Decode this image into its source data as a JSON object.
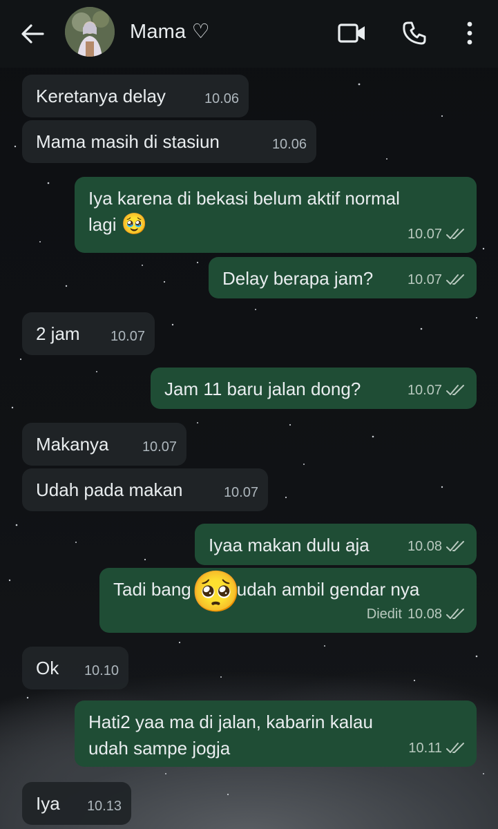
{
  "header": {
    "title": "Mama ♡",
    "icons": [
      "back-arrow-icon",
      "video-call-icon",
      "phone-icon",
      "more-vertical-icon"
    ]
  },
  "colors": {
    "incoming_bubble": "#202428",
    "outgoing_bubble": "#1f4d35",
    "header_bg": "#111416"
  },
  "messages": [
    {
      "dir": "in",
      "text": "Keretanya delay",
      "time": "10.06"
    },
    {
      "dir": "in",
      "text": "Mama masih di stasiun",
      "time": "10.06"
    },
    {
      "dir": "out",
      "line1": "Iya karena di bekasi belum aktif normal",
      "line2": "lagi",
      "emoji": "🥹",
      "time": "10.07"
    },
    {
      "dir": "out",
      "text": "Delay berapa jam?",
      "time": "10.07"
    },
    {
      "dir": "in",
      "text": "2 jam",
      "time": "10.07"
    },
    {
      "dir": "out",
      "text": "Jam 11 baru jalan dong?",
      "time": "10.07"
    },
    {
      "dir": "in",
      "text": "Makanya",
      "time": "10.07"
    },
    {
      "dir": "in",
      "text": "Udah pada makan",
      "time": "10.07"
    },
    {
      "dir": "out",
      "text": "Iyaa makan dulu aja",
      "time": "10.08"
    },
    {
      "dir": "out",
      "before": "Tadi bang",
      "emoji": "🥺",
      "after": "udah ambil gendar nya",
      "edited": "Diedit",
      "time": "10.08"
    },
    {
      "dir": "in",
      "text": "Ok",
      "time": "10.10"
    },
    {
      "dir": "out",
      "line1": "Hati2 yaa ma di jalan, kabarin kalau",
      "line2": "udah sampe jogja",
      "time": "10.11"
    },
    {
      "dir": "in",
      "text": "Iya",
      "time": "10.13"
    }
  ]
}
